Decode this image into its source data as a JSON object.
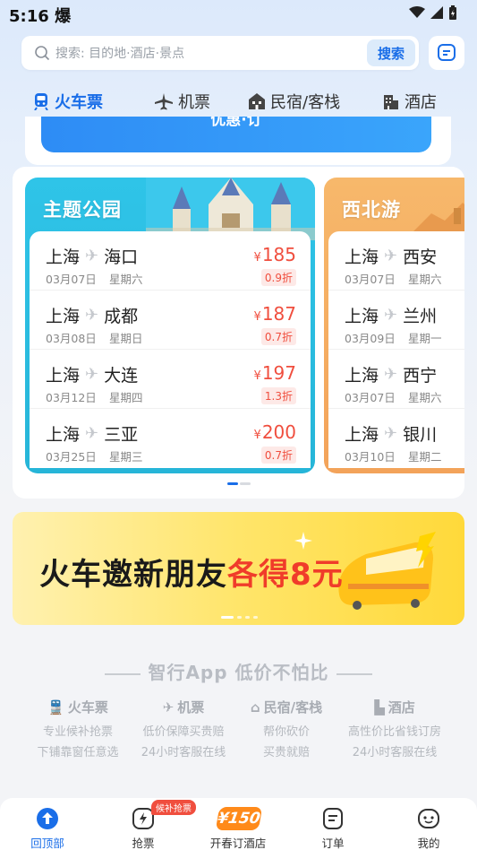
{
  "status_bar": {
    "time": "5:16",
    "indicator": "爆"
  },
  "search": {
    "placeholder": "搜索: 目的地·酒店·景点",
    "button": "搜索"
  },
  "tabs": [
    {
      "label": "火车票",
      "icon": "train-icon",
      "active": true
    },
    {
      "label": "机票",
      "icon": "plane-icon"
    },
    {
      "label": "民宿/客栈",
      "icon": "house-icon"
    },
    {
      "label": "酒店",
      "icon": "hotel-icon"
    }
  ],
  "promo_button": "优惠·订",
  "themes": [
    {
      "title": "主题公园",
      "routes": [
        {
          "from": "上海",
          "to": "海口",
          "date": "03月07日",
          "weekday": "星期六",
          "price": "185",
          "discount": "0.9折"
        },
        {
          "from": "上海",
          "to": "成都",
          "date": "03月08日",
          "weekday": "星期日",
          "price": "187",
          "discount": "0.7折"
        },
        {
          "from": "上海",
          "to": "大连",
          "date": "03月12日",
          "weekday": "星期四",
          "price": "197",
          "discount": "1.3折"
        },
        {
          "from": "上海",
          "to": "三亚",
          "date": "03月25日",
          "weekday": "星期三",
          "price": "200",
          "discount": "0.7折"
        }
      ]
    },
    {
      "title": "西北游",
      "routes": [
        {
          "from": "上海",
          "to": "西安",
          "date": "03月07日",
          "weekday": "星期六"
        },
        {
          "from": "上海",
          "to": "兰州",
          "date": "03月09日",
          "weekday": "星期一"
        },
        {
          "from": "上海",
          "to": "西宁",
          "date": "03月07日",
          "weekday": "星期六"
        },
        {
          "from": "上海",
          "to": "银川",
          "date": "03月10日",
          "weekday": "星期二"
        }
      ]
    }
  ],
  "currency": "¥",
  "banner": {
    "text_main": "火车邀新朋友",
    "text_highlight": "各得8元"
  },
  "slogan": "智行App 低价不怕比",
  "features": [
    {
      "title": "火车票",
      "lines": [
        "专业候补抢票",
        "下铺靠窗任意选"
      ]
    },
    {
      "title": "机票",
      "lines": [
        "低价保障买贵赔",
        "24小时客服在线"
      ]
    },
    {
      "title": "民宿/客栈",
      "lines": [
        "帮你砍价",
        "买贵就赔"
      ]
    },
    {
      "title": "酒店",
      "lines": [
        "高性价比省钱订房",
        "24小时客服在线"
      ]
    }
  ],
  "bottom_nav": [
    {
      "label": "回顶部",
      "active": true
    },
    {
      "label": "抢票",
      "badge": "候补抢票"
    },
    {
      "label": "开春订酒店",
      "badge_text": "¥150"
    },
    {
      "label": "订单"
    },
    {
      "label": "我的"
    }
  ],
  "colors": {
    "primary": "#1a6ee8",
    "price": "#f04e3e",
    "theme_blue": "#2fc4e8",
    "theme_orange": "#f7b86b"
  }
}
